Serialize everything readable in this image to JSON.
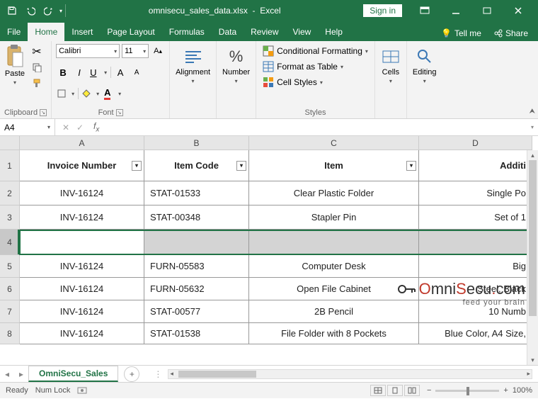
{
  "titlebar": {
    "filename": "omnisecu_sales_data.xlsx",
    "appname": "Excel",
    "signin": "Sign in"
  },
  "tabs": {
    "items": [
      "File",
      "Home",
      "Insert",
      "Page Layout",
      "Formulas",
      "Data",
      "Review",
      "View",
      "Help"
    ],
    "active": 1,
    "tellme": "Tell me",
    "share": "Share"
  },
  "ribbon": {
    "clipboard": {
      "paste": "Paste",
      "label": "Clipboard"
    },
    "font": {
      "name": "Calibri",
      "size": "11",
      "label": "Font"
    },
    "alignment": {
      "big": "Alignment"
    },
    "number": {
      "big": "Number",
      "percent": "%"
    },
    "styles": {
      "cond": "Conditional Formatting",
      "table": "Format as Table",
      "cell": "Cell Styles",
      "label": "Styles"
    },
    "cells": {
      "big": "Cells"
    },
    "editing": {
      "big": "Editing"
    }
  },
  "formulabar": {
    "namebox": "A4",
    "formula": ""
  },
  "columns": [
    "A",
    "B",
    "C",
    "D"
  ],
  "rows": [
    "1",
    "2",
    "3",
    "4",
    "5",
    "6",
    "7",
    "8"
  ],
  "headers": [
    "Invoice Number",
    "Item Code",
    "Item",
    "Additi"
  ],
  "data": [
    [
      "INV-16124",
      "STAT-01533",
      "Clear Plastic Folder",
      "Single Po"
    ],
    [
      "INV-16124",
      "STAT-00348",
      "Stapler Pin",
      "Set of 1"
    ],
    [
      "",
      "",
      "",
      ""
    ],
    [
      "INV-16124",
      "FURN-05583",
      "Computer Desk",
      "Big"
    ],
    [
      "INV-16124",
      "FURN-05632",
      "Open File Cabinet",
      "Steel, Black"
    ],
    [
      "INV-16124",
      "STAT-00577",
      "2B Pencil",
      "10 Numb"
    ],
    [
      "INV-16124",
      "STAT-01538",
      "File Folder with 8 Pockets",
      "Blue Color, A4 Size,"
    ]
  ],
  "sheet": {
    "name": "OmniSecu_Sales"
  },
  "statusbar": {
    "ready": "Ready",
    "numlock": "Num Lock",
    "zoom": "100%"
  },
  "watermark": {
    "main": "OmniSecu.com",
    "sub": "feed your brain"
  }
}
